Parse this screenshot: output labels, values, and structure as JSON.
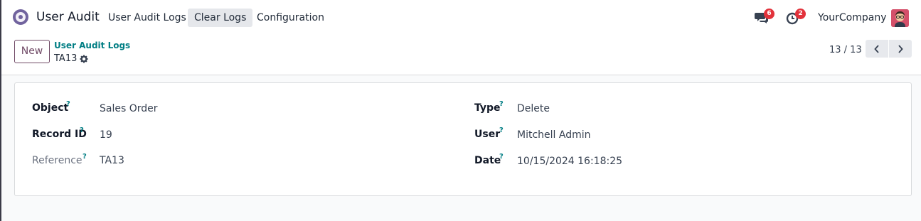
{
  "app": {
    "name": "User Audit",
    "icon": "user-audit-app-icon"
  },
  "menu": [
    {
      "label": "User Audit Logs"
    },
    {
      "label": "Clear Logs"
    },
    {
      "label": "Configuration"
    }
  ],
  "systray": {
    "messages_icon": "chat-bubbles-icon",
    "messages_count": "6",
    "activity_icon": "clock-icon",
    "activity_count": "2",
    "company": "YourCompany"
  },
  "control_panel": {
    "new_label": "New",
    "breadcrumb": "User Audit Logs",
    "record_name": "TA13",
    "pager": "13 / 13"
  },
  "form": {
    "left": [
      {
        "label": "Object",
        "help": "?",
        "value": "Sales Order"
      },
      {
        "label": "Record ID",
        "help": "?",
        "value": "19"
      },
      {
        "label": "Reference",
        "help": "?",
        "value": "TA13"
      }
    ],
    "right": [
      {
        "label": "Type",
        "help": "?",
        "value": "Delete"
      },
      {
        "label": "User",
        "help": "?",
        "value": "Mitchell Admin"
      },
      {
        "label": "Date",
        "help": "?",
        "value": "10/15/2024 16:18:25"
      }
    ]
  },
  "colors": {
    "brand": "#714b67",
    "link": "#017e84",
    "badge": "#e2323b"
  }
}
